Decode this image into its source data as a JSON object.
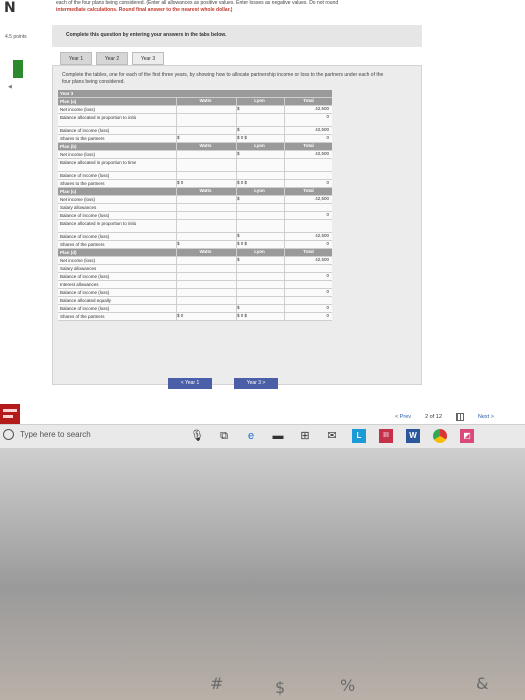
{
  "header": {
    "corner_glyph": "N",
    "instruction_line1": "each of the four plans being considered. (Enter all allowances as positive values. Enter losses as negative values. Do not round",
    "instruction_line2": "intermediate calculations. Round final answer to the nearest whole dollar.)",
    "left_badge": "4.5 points"
  },
  "banner": {
    "text": "Complete this question by entering your answers in the tabs below."
  },
  "tabs": [
    "Year 1",
    "Year 2",
    "Year 3"
  ],
  "instructions": "Complete the tables, one for each of the first three years, by showing how to allocate partnership income or loss to the partners under each of the four plans being considered.",
  "table": {
    "year_label": "Year 3",
    "columns": [
      "Watts",
      "Lyon",
      "Total"
    ],
    "rows": [
      {
        "label": "Plan (a)",
        "type": "head",
        "c1": "Watts",
        "c2": "Lyon",
        "c3": "Total"
      },
      {
        "label": "Net income (loss)",
        "c1": "",
        "c2": "$",
        "c3": "42,500"
      },
      {
        "label": "Balance allocated in proportion to initial investment",
        "c1": "",
        "c2": "",
        "c3": "0",
        "tall": true
      },
      {
        "label": "Balance of income (loss)",
        "c1": "",
        "c2": "$",
        "c3": "42,500"
      },
      {
        "label": "Shares to the partners",
        "c1": "$",
        "c2": "$ 0  $",
        "c3": "0"
      },
      {
        "label": "Plan (b)",
        "type": "head",
        "c1": "Watts",
        "c2": "Lyon",
        "c3": "Total"
      },
      {
        "label": "Net income (loss)",
        "c1": "",
        "c2": "$",
        "c3": "42,500"
      },
      {
        "label": "Balance allocated in proportion to time devoted",
        "c1": "",
        "c2": "",
        "c3": "",
        "tall": true
      },
      {
        "label": "Balance of income (loss)",
        "c1": "",
        "c2": "",
        "c3": ""
      },
      {
        "label": "Shares to the partners",
        "c1": "$ 0",
        "c2": "$ 0  $",
        "c3": "0"
      },
      {
        "label": "Plan (c)",
        "type": "head",
        "c1": "Watts",
        "c2": "Lyon",
        "c3": "Total"
      },
      {
        "label": "Net income (loss)",
        "c1": "",
        "c2": "$",
        "c3": "42,500"
      },
      {
        "label": "Salary allowances",
        "c1": "",
        "c2": "",
        "c3": ""
      },
      {
        "label": "Balance of income (loss)",
        "c1": "",
        "c2": "",
        "c3": "0"
      },
      {
        "label": "Balance allocated in proportion to initial investments",
        "c1": "",
        "c2": "",
        "c3": "",
        "tall": true
      },
      {
        "label": "Balance of income (loss)",
        "c1": "",
        "c2": "$",
        "c3": "42,500"
      },
      {
        "label": "Shares of the partners",
        "c1": "$",
        "c2": "$ 0  $",
        "c3": "0"
      },
      {
        "label": "Plan (d)",
        "type": "head",
        "c1": "Watts",
        "c2": "Lyon",
        "c3": "Total"
      },
      {
        "label": "Net income (loss)",
        "c1": "",
        "c2": "$",
        "c3": "42,500"
      },
      {
        "label": "Salary allowances",
        "c1": "",
        "c2": "",
        "c3": ""
      },
      {
        "label": "Balance of income (loss)",
        "c1": "",
        "c2": "",
        "c3": "0"
      },
      {
        "label": "Interest allowances",
        "c1": "",
        "c2": "",
        "c3": ""
      },
      {
        "label": "Balance of income (loss)",
        "c1": "",
        "c2": "",
        "c3": "0"
      },
      {
        "label": "Balance allocated equally",
        "c1": "",
        "c2": "",
        "c3": ""
      },
      {
        "label": "Balance of income (loss)",
        "c1": "",
        "c2": "$",
        "c3": "0"
      },
      {
        "label": "Shares of the partners",
        "c1": "$ 0",
        "c2": "$ 0  $",
        "c3": "0"
      }
    ]
  },
  "year_nav": {
    "prev": "< Year 1",
    "next": "Year 3 >"
  },
  "pager": {
    "prev": "< Prev",
    "page": "2 of 12",
    "next": "Next >"
  },
  "taskbar": {
    "search_placeholder": "Type here to search"
  },
  "colors": {
    "brand_red": "#b31b1b",
    "nav_blue": "#4a5fa8",
    "plan_head": "#9a9a9a"
  }
}
